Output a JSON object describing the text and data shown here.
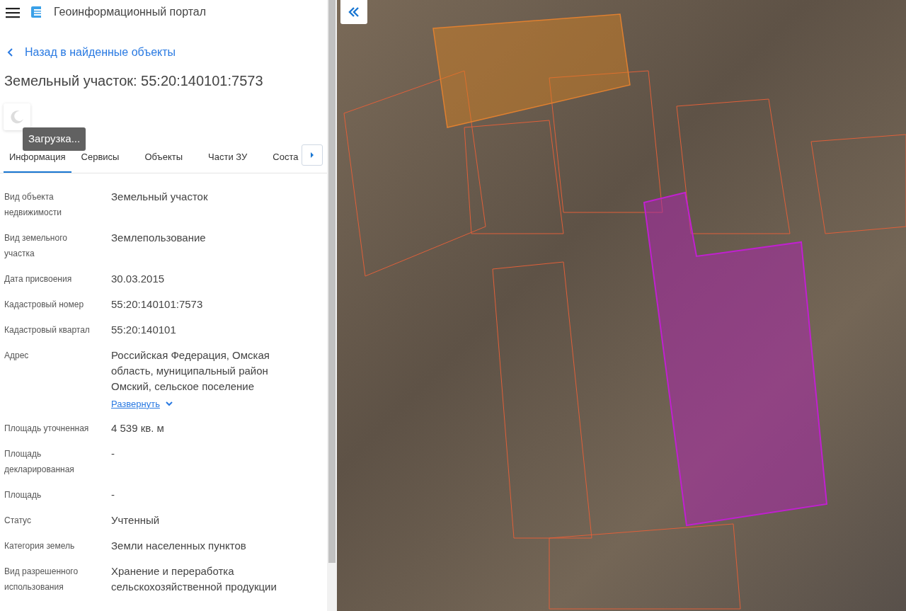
{
  "header": {
    "title": "Геоинформационный портал"
  },
  "back_link": {
    "label": "Назад в найденные объекты"
  },
  "heading": "Земельный участок: 55:20:140101:7573",
  "loading_tooltip": "Загрузка...",
  "tabs": [
    {
      "label": "Информация",
      "selected": true
    },
    {
      "label": "Сервисы",
      "selected": false
    },
    {
      "label": "Объекты",
      "selected": false
    },
    {
      "label": "Части ЗУ",
      "selected": false
    },
    {
      "label": "Соста",
      "selected": false
    }
  ],
  "fields": [
    {
      "label": "Вид объекта недвижимости",
      "value": "Земельный участок"
    },
    {
      "label": "Вид земельного участка",
      "value": "Землепользование"
    },
    {
      "label": "Дата присвоения",
      "value": "30.03.2015"
    },
    {
      "label": "Кадастровый номер",
      "value": "55:20:140101:7573"
    },
    {
      "label": "Кадастровый квартал",
      "value": "55:20:140101"
    },
    {
      "label": "Адрес",
      "value": "Российская Федерация, Омская область, муниципальный район Омский, сельское поселение",
      "expand_link": "Развернуть"
    },
    {
      "label": "Площадь уточненная",
      "value": "4 539 кв. м"
    },
    {
      "label": "Площадь декларированная",
      "value": "-"
    },
    {
      "label": "Площадь",
      "value": "-"
    },
    {
      "label": "Статус",
      "value": "Учтенный"
    },
    {
      "label": "Категория земель",
      "value": "Земли населенных пунктов"
    },
    {
      "label": "Вид разрешенного использования",
      "value": "Хранение и переработка сельскохозяйственной продукции"
    }
  ]
}
